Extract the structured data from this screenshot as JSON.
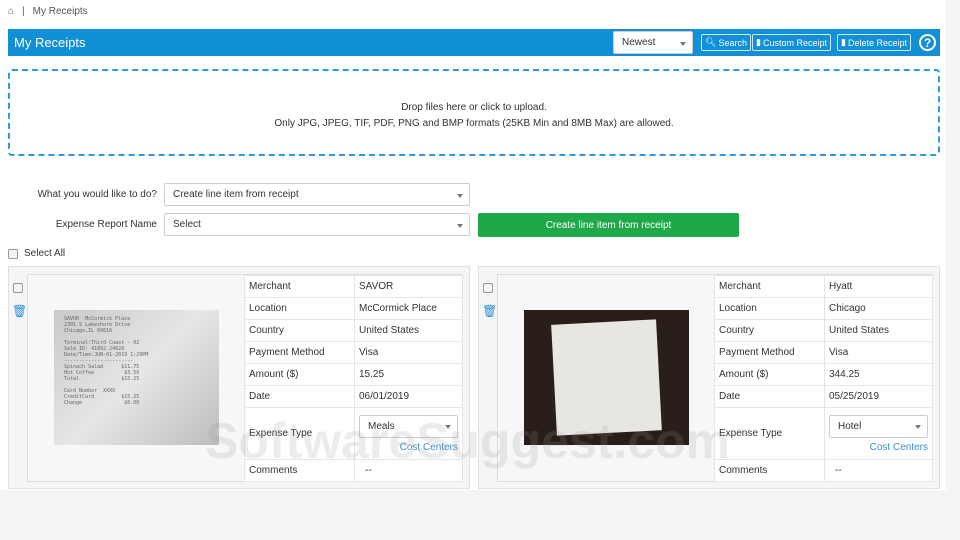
{
  "breadcrumb": {
    "current": "My Receipts"
  },
  "header": {
    "title": "My Receipts",
    "sort": "Newest",
    "search": "Search",
    "custom": "Custom Receipt",
    "delete": "Delete Receipt",
    "help": "?"
  },
  "upload": {
    "line1": "Drop files here or click to upload.",
    "line2": "Only JPG, JPEG, TIF, PDF, PNG and BMP formats (25KB Min and 8MB Max) are allowed."
  },
  "form": {
    "action_label": "What you would like to do?",
    "action_value": "Create line item from receipt",
    "report_label": "Expense Report Name",
    "report_value": "Select",
    "create_button": "Create line item from receipt",
    "select_all": "Select All"
  },
  "labels": {
    "merchant": "Merchant",
    "location": "Location",
    "country": "Country",
    "payment": "Payment Method",
    "amount": "Amount ($)",
    "date": "Date",
    "expense": "Expense Type",
    "comments": "Comments",
    "cost_centers": "Cost Centers"
  },
  "receipts": [
    {
      "merchant": "SAVOR",
      "location": "McCormick Place",
      "country": "United States",
      "payment": "Visa",
      "amount": "15.25",
      "date": "06/01/2019",
      "expense": "Meals",
      "comments": "--"
    },
    {
      "merchant": "Hyatt",
      "location": "Chicago",
      "country": "United States",
      "payment": "Visa",
      "amount": "344.25",
      "date": "05/25/2019",
      "expense": "Hotel",
      "comments": "--"
    }
  ],
  "watermark": "SoftwareSuggest.com"
}
